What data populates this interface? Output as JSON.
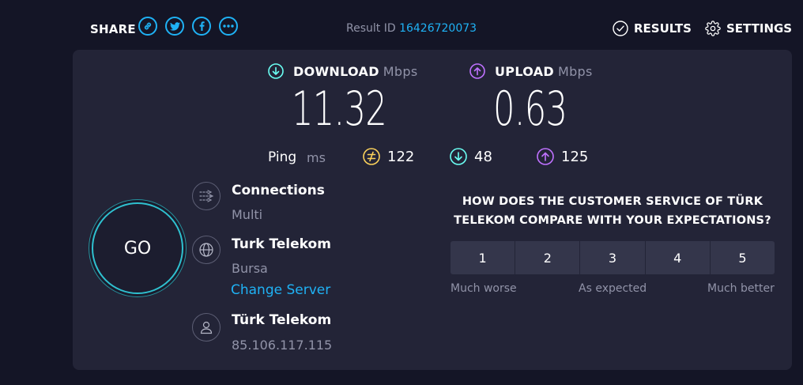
{
  "header": {
    "share_label": "SHARE",
    "share_icons": [
      "link-icon",
      "twitter-icon",
      "facebook-icon",
      "more-icon"
    ],
    "result_id_label": "Result ID",
    "result_id_value": "16426720073",
    "results_label": "RESULTS",
    "settings_label": "SETTINGS"
  },
  "download": {
    "label": "DOWNLOAD",
    "unit": "Mbps",
    "value": "11.32",
    "color": "#6afff3"
  },
  "upload": {
    "label": "UPLOAD",
    "unit": "Mbps",
    "value": "0.63",
    "color": "#bf71ff"
  },
  "ping": {
    "label": "Ping",
    "unit": "ms",
    "idle": "122",
    "download": "48",
    "upload": "125",
    "idle_color": "#fbd15b"
  },
  "go_label": "GO",
  "connections": {
    "title": "Connections",
    "value": "Multi"
  },
  "server": {
    "name": "Turk Telekom",
    "location": "Bursa",
    "change_label": "Change Server"
  },
  "provider": {
    "name": "Türk Telekom",
    "ip": "85.106.117.115"
  },
  "survey": {
    "question_line1": "HOW DOES THE CUSTOMER SERVICE OF TÜRK",
    "question_line2": "TELEKOM COMPARE WITH YOUR EXPECTATIONS?",
    "options": [
      "1",
      "2",
      "3",
      "4",
      "5"
    ],
    "label_low": "Much worse",
    "label_mid": "As expected",
    "label_high": "Much better"
  },
  "accent_color": "#1fb2f5"
}
